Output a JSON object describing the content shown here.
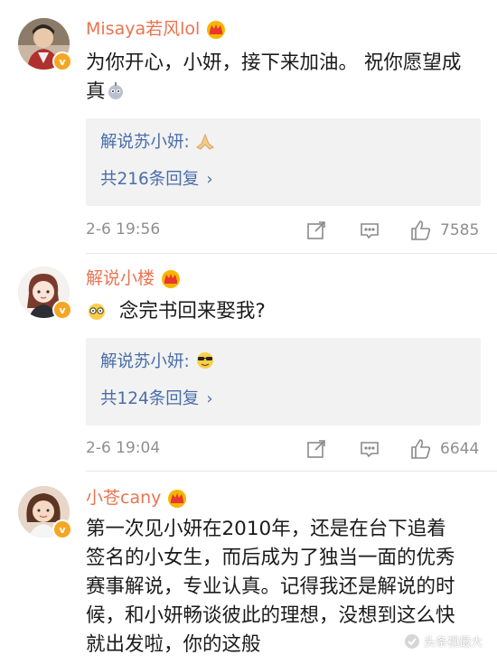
{
  "comments": [
    {
      "username": "Misaya若风lol",
      "text": "为你开心，小妍，接下来加油。 祝你愿望成真",
      "reply_author": "解说苏小妍:",
      "reply_emoji": "praying-hands-emoji",
      "reply_count": "共216条回复",
      "timestamp": "2-6 19:56",
      "likes": "7585"
    },
    {
      "username": "解说小楼",
      "text": "念完书回来娶我?",
      "reply_author": "解说苏小妍:",
      "reply_emoji": "sunglasses-emoji",
      "reply_count": "共124条回复",
      "timestamp": "2-6 19:04",
      "likes": "6644"
    },
    {
      "username": "小苍cany",
      "text": "第一次见小妍在2010年，还是在台下追着签名的小女生，而后成为了独当一面的优秀赛事解说，专业认真。记得我还是解说的时候，和小妍畅谈彼此的理想，没想到这么快就出发啦，你的这般"
    }
  ],
  "watermark": "头条视最大",
  "colors": {
    "username": "#eb7350",
    "link": "#4a6ea9",
    "meta": "#8f8f8f",
    "reply_bg": "#f2f2f2",
    "vip_badge": "#f5a623"
  }
}
